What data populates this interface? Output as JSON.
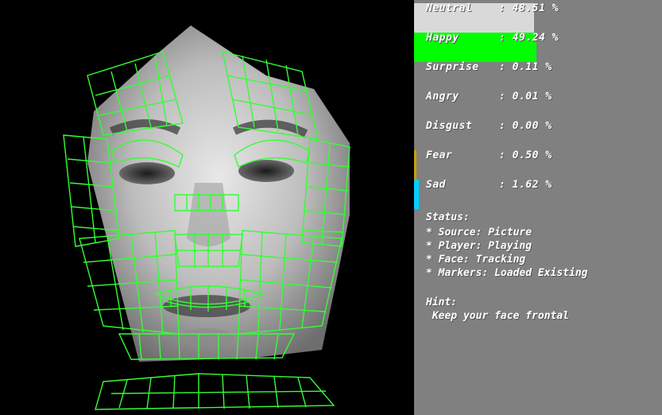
{
  "colors": {
    "panel_bg": "#808080",
    "mesh": "#33ff33",
    "neutral_bar": "#d9d9d9",
    "happy_bar": "#00ff00",
    "fear_bar": "#c8a000",
    "sad_bar": "#00d0ff"
  },
  "emotions": [
    {
      "label": "Neutral",
      "value": "48.51 %",
      "level": 0.4851
    },
    {
      "label": "Happy",
      "value": "49.24 %",
      "level": 0.4924
    },
    {
      "label": "Surprise",
      "value": "0.11 %",
      "level": 0.0011
    },
    {
      "label": "Angry",
      "value": "0.01 %",
      "level": 0.0001
    },
    {
      "label": "Disgust",
      "value": "0.00 %",
      "level": 0
    },
    {
      "label": "Fear",
      "value": "0.50 %",
      "level": 0.005
    },
    {
      "label": "Sad",
      "value": "1.62 %",
      "level": 0.0162
    }
  ],
  "status": {
    "title": "Status:",
    "source": "* Source: Picture",
    "player": "* Player: Playing",
    "face": "* Face: Tracking",
    "markers": "* Markers: Loaded Existing"
  },
  "hint": {
    "title": "Hint:",
    "text": " Keep your face frontal"
  },
  "icons": {
    "face_mesh": "face-tracking-mesh"
  }
}
